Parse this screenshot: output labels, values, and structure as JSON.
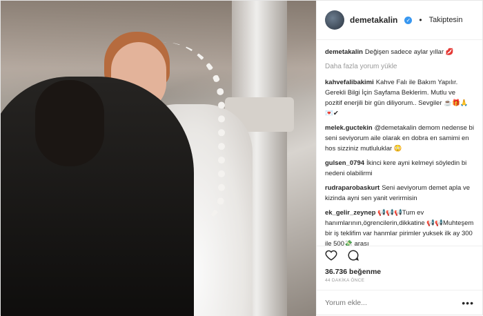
{
  "post": {
    "username": "demetakalin",
    "follow_status": "Takiptesin",
    "likes": "36.736 beğenme",
    "time": "44 DAKİKA ÖNCE",
    "load_more": "Daha fazla yorum yükle",
    "add_comment_placeholder": "Yorum ekle...",
    "more_label": "•••"
  },
  "comments": [
    {
      "user": "demetakalin",
      "text": "Değişen sadece aylar yıllar"
    },
    {
      "user": "kahvefalibakimi",
      "text": "Kahve Falı ile Bakım Yapılır. Gerekli Bilgi İçin Sayfama Beklerim. Mutlu ve pozitif enerjili bir gün diliyorum.. Sevgiler ☕🎁🙏💌✔"
    },
    {
      "user": "melek.guctekin",
      "text": "@demetakalin demom nedense bi seni seviyorum aile olarak en dobra en samimi en hos sizziniz mutluluklar 😳"
    },
    {
      "user": "gulsen_0794",
      "text": "İkinci kere ayni kelmeyi söyledin bi nedeni olabilirmi"
    },
    {
      "user": "rudraparobaskurt",
      "text": "Seni aeviyorum demet apla ve kizinda ayni sen yanit verirmisin"
    },
    {
      "user": "ek_gelir_zeynep",
      "text": "📢📢📢Tum ev hanımlarının,ögrencilerin,dikkatine 📢📢Muhteşem bir iş teklifim var hanmlar pirimler yuksek ilk ay 300 ile 500💸 arası"
    }
  ]
}
